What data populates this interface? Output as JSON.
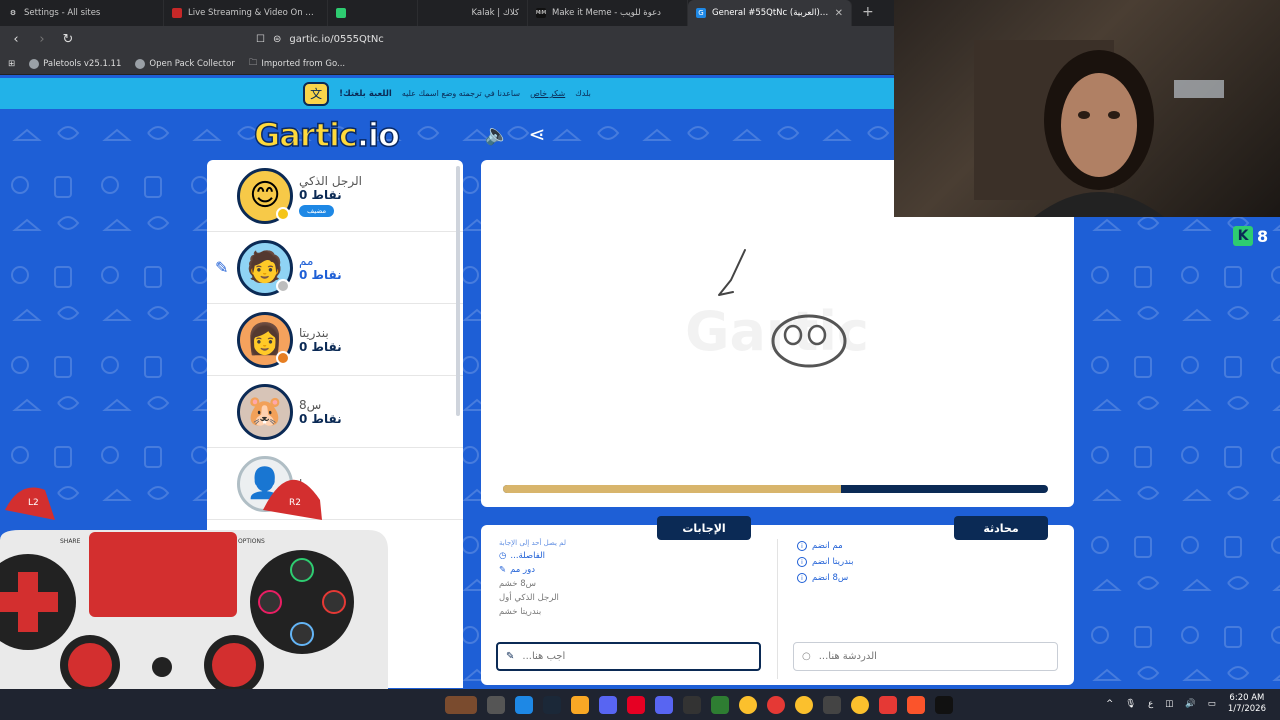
{
  "browser": {
    "tabs": [
      {
        "title": "Settings - All sites",
        "icon": "gear-icon",
        "color": "#5f6368"
      },
      {
        "title": "Live Streaming & Video On Demand",
        "icon": "streaming-icon",
        "color": "#c62828"
      },
      {
        "title": "",
        "icon": "discord-icon",
        "color": "#2ecc71"
      },
      {
        "title": "Kalak | كلاك",
        "icon": "kalak-icon",
        "color": "#202124"
      },
      {
        "title": "Make it Meme - دعوة للويب",
        "icon": "mim-icon",
        "color": "#111"
      },
      {
        "title": "General #55QtNc (العربية) - Gartic",
        "icon": "gartic-icon",
        "color": "#1e88e5"
      }
    ],
    "url": "gartic.io/0555QtNc",
    "bookmarks": [
      "Paletools v25.1.11",
      "Open Pack Collector",
      "Imported from Go..."
    ]
  },
  "banner": {
    "bold": "!اللعبة بلغتك",
    "text": "ساعدنا في ترجمته وضع اسمك عليه",
    "link": "شكر خاص",
    "suffix": "بلدك"
  },
  "game": {
    "logo_main": "Gartic",
    "logo_suffix": ".io",
    "players": [
      {
        "name": "الرجل الذكي",
        "points": "0",
        "points_label": "نقاط",
        "badge": "مضيف",
        "avatar": "😊",
        "avatar_bg": "#f7c948",
        "dot": "#f5c518"
      },
      {
        "name": "مم",
        "points": "0",
        "points_label": "نقاط",
        "avatar": "🧑",
        "avatar_bg": "#8fd3f4",
        "dot": "#bdbdbd",
        "drawing": true
      },
      {
        "name": "بندريتا",
        "points": "0",
        "points_label": "نقاط",
        "avatar": "👩",
        "avatar_bg": "#f5a25d",
        "dot": "#e67e22"
      },
      {
        "name": "س8",
        "points": "0",
        "points_label": "نقاط",
        "avatar": "🐹",
        "avatar_bg": "#d7c4b7",
        "dot": ""
      },
      {
        "name": "ا",
        "points": "",
        "points_label": "",
        "avatar": "👤",
        "avatar_bg": "#eceff1",
        "dot": ""
      }
    ],
    "progress": 0.62,
    "answers_title": "الإجابات",
    "chat_title": "محادثة",
    "answers": [
      {
        "text": "لم يصل أحد إلى الإجابة",
        "style": "blue",
        "icon": ""
      },
      {
        "text": "...الفاصلة",
        "style": "blue",
        "icon": "clock-icon"
      },
      {
        "text": "دور مم",
        "style": "blue",
        "icon": "pencil-icon"
      },
      {
        "text": "س8 خشم",
        "style": "gray",
        "icon": ""
      },
      {
        "text": "الرجل الذكي أول",
        "style": "gray",
        "icon": ""
      },
      {
        "text": "بندريتا خشم",
        "style": "gray",
        "icon": ""
      }
    ],
    "chat": [
      {
        "text": "مم انضم"
      },
      {
        "text": "بندريتا انضم"
      },
      {
        "text": "س8 انضم"
      }
    ],
    "answer_placeholder": "...أجب هنا",
    "chat_placeholder": "...الدردشة هنا",
    "k_score": "8"
  },
  "taskbar": {
    "time": "6:20 AM",
    "date": "1/7/2026",
    "lang": "ع"
  },
  "controller": {
    "left_trigger": "L2",
    "right_trigger": "R2",
    "share": "SHARE",
    "options": "OPTIONS"
  }
}
